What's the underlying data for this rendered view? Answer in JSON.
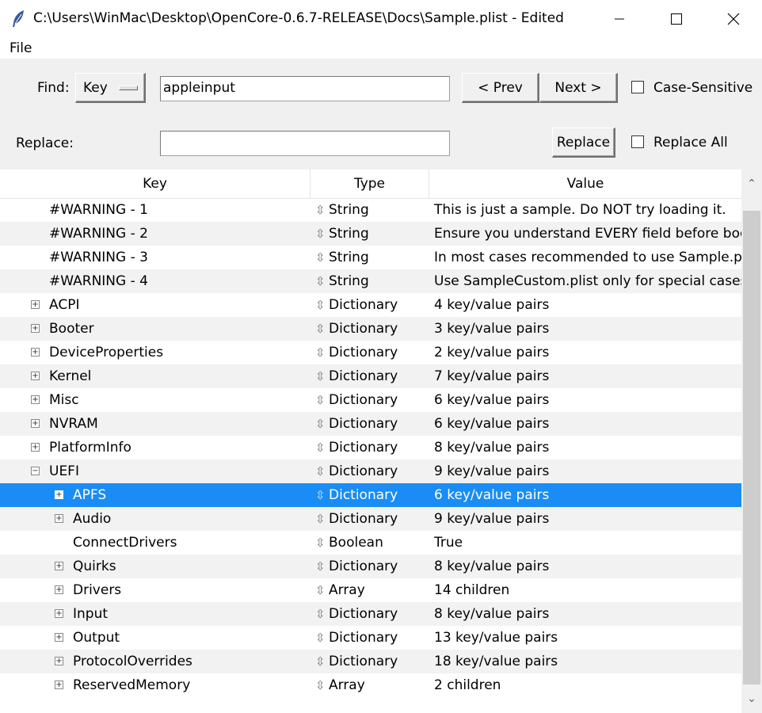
{
  "window": {
    "title": "C:\\Users\\WinMac\\Desktop\\OpenCore-0.6.7-RELEASE\\Docs\\Sample.plist - Edited",
    "icon": "feather-icon",
    "controls": {
      "minimize": "minimize-icon",
      "maximize": "maximize-icon",
      "close": "close-icon"
    }
  },
  "menu": {
    "file": "File"
  },
  "find": {
    "label": "Find:",
    "type_selected": "Key",
    "query": "appleinput",
    "prev": "< Prev",
    "next": "Next >",
    "case_sensitive_label": "Case-Sensitive",
    "case_sensitive": false
  },
  "replace": {
    "label": "Replace:",
    "value": "",
    "button": "Replace",
    "replace_all_label": "Replace All",
    "replace_all": false
  },
  "tree": {
    "columns": [
      "Key",
      "Type",
      "Value"
    ],
    "rows": [
      {
        "key": "#WARNING - 1",
        "type": "String",
        "value": "This is just a sample. Do NOT try loading it.",
        "expander": "",
        "level": 1
      },
      {
        "key": "#WARNING - 2",
        "type": "String",
        "value": "Ensure you understand EVERY field before booting",
        "expander": "",
        "level": 1
      },
      {
        "key": "#WARNING - 3",
        "type": "String",
        "value": "In most cases recommended to use Sample.plist",
        "expander": "",
        "level": 1
      },
      {
        "key": "#WARNING - 4",
        "type": "String",
        "value": "Use SampleCustom.plist only for special cases.",
        "expander": "",
        "level": 1
      },
      {
        "key": "ACPI",
        "type": "Dictionary",
        "value": "4 key/value pairs",
        "expander": "+",
        "level": 1
      },
      {
        "key": "Booter",
        "type": "Dictionary",
        "value": "3 key/value pairs",
        "expander": "+",
        "level": 1
      },
      {
        "key": "DeviceProperties",
        "type": "Dictionary",
        "value": "2 key/value pairs",
        "expander": "+",
        "level": 1
      },
      {
        "key": "Kernel",
        "type": "Dictionary",
        "value": "7 key/value pairs",
        "expander": "+",
        "level": 1
      },
      {
        "key": "Misc",
        "type": "Dictionary",
        "value": "6 key/value pairs",
        "expander": "+",
        "level": 1
      },
      {
        "key": "NVRAM",
        "type": "Dictionary",
        "value": "6 key/value pairs",
        "expander": "+",
        "level": 1
      },
      {
        "key": "PlatformInfo",
        "type": "Dictionary",
        "value": "8 key/value pairs",
        "expander": "+",
        "level": 1
      },
      {
        "key": "UEFI",
        "type": "Dictionary",
        "value": "9 key/value pairs",
        "expander": "−",
        "level": 1
      },
      {
        "key": "APFS",
        "type": "Dictionary",
        "value": "6 key/value pairs",
        "expander": "+",
        "level": 2,
        "selected": true
      },
      {
        "key": "Audio",
        "type": "Dictionary",
        "value": "9 key/value pairs",
        "expander": "+",
        "level": 2
      },
      {
        "key": "ConnectDrivers",
        "type": "Boolean",
        "value": "True",
        "expander": "",
        "level": 2
      },
      {
        "key": "Quirks",
        "type": "Dictionary",
        "value": "8 key/value pairs",
        "expander": "+",
        "level": 2
      },
      {
        "key": "Drivers",
        "type": "Array",
        "value": "14 children",
        "expander": "+",
        "level": 2
      },
      {
        "key": "Input",
        "type": "Dictionary",
        "value": "8 key/value pairs",
        "expander": "+",
        "level": 2
      },
      {
        "key": "Output",
        "type": "Dictionary",
        "value": "13 key/value pairs",
        "expander": "+",
        "level": 2
      },
      {
        "key": "ProtocolOverrides",
        "type": "Dictionary",
        "value": "18 key/value pairs",
        "expander": "+",
        "level": 2
      },
      {
        "key": "ReservedMemory",
        "type": "Array",
        "value": "2 children",
        "expander": "+",
        "level": 2
      }
    ],
    "type_icon": "⇳"
  },
  "colors": {
    "selection": "#1a8cf5",
    "alt_row": "#f2f2f2",
    "panel": "#f0f0f0"
  }
}
